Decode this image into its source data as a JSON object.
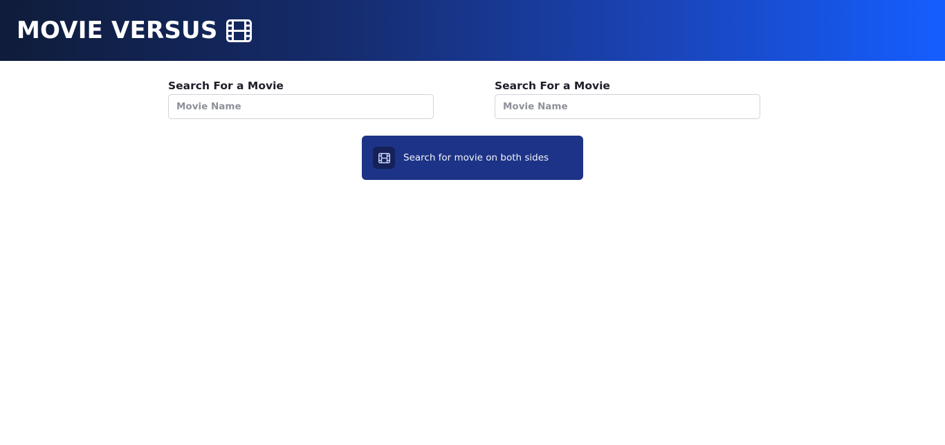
{
  "header": {
    "title": "MOVIE VERSUS",
    "icon": "film-icon"
  },
  "search": {
    "left": {
      "label": "Search For a Movie",
      "placeholder": "Movie Name",
      "value": ""
    },
    "right": {
      "label": "Search For a Movie",
      "placeholder": "Movie Name",
      "value": ""
    }
  },
  "action_button": {
    "label": "Search for movie on both sides",
    "icon": "film-icon"
  },
  "colors": {
    "header_gradient_start": "#0f1c3a",
    "header_gradient_end": "#155eff",
    "button_background": "#1d3387",
    "button_icon_background": "#152159"
  }
}
